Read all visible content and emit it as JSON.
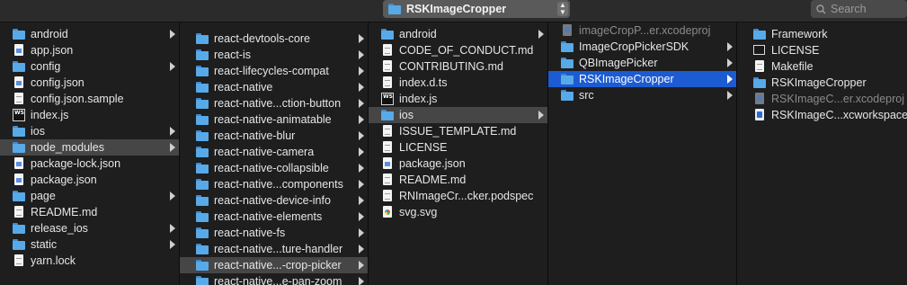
{
  "toolbar": {
    "path_title": "RSKImageCropper",
    "search_placeholder": "Search"
  },
  "columns": [
    {
      "name": "column-1",
      "items": [
        {
          "label": "android",
          "icon": "folder",
          "has_children": true
        },
        {
          "label": "app.json",
          "icon": "doc-blue"
        },
        {
          "label": "config",
          "icon": "folder",
          "has_children": true
        },
        {
          "label": "config.json",
          "icon": "doc-blue"
        },
        {
          "label": "config.json.sample",
          "icon": "doc"
        },
        {
          "label": "index.js",
          "icon": "webstorm"
        },
        {
          "label": "ios",
          "icon": "folder",
          "has_children": true
        },
        {
          "label": "node_modules",
          "icon": "folder",
          "has_children": true,
          "selected": "gray"
        },
        {
          "label": "package-lock.json",
          "icon": "doc-blue"
        },
        {
          "label": "package.json",
          "icon": "doc-blue"
        },
        {
          "label": "page",
          "icon": "folder",
          "has_children": true
        },
        {
          "label": "README.md",
          "icon": "doc"
        },
        {
          "label": "release_ios",
          "icon": "folder",
          "has_children": true
        },
        {
          "label": "static",
          "icon": "folder",
          "has_children": true
        },
        {
          "label": "yarn.lock",
          "icon": "doc"
        }
      ]
    },
    {
      "name": "column-2",
      "items": [
        {
          "label": "react-devtools-core",
          "icon": "folder",
          "has_children": true
        },
        {
          "label": "react-is",
          "icon": "folder",
          "has_children": true
        },
        {
          "label": "react-lifecycles-compat",
          "icon": "folder",
          "has_children": true
        },
        {
          "label": "react-native",
          "icon": "folder",
          "has_children": true
        },
        {
          "label": "react-native...ction-button",
          "icon": "folder",
          "has_children": true
        },
        {
          "label": "react-native-animatable",
          "icon": "folder",
          "has_children": true
        },
        {
          "label": "react-native-blur",
          "icon": "folder",
          "has_children": true
        },
        {
          "label": "react-native-camera",
          "icon": "folder",
          "has_children": true
        },
        {
          "label": "react-native-collapsible",
          "icon": "folder",
          "has_children": true
        },
        {
          "label": "react-native...components",
          "icon": "folder",
          "has_children": true
        },
        {
          "label": "react-native-device-info",
          "icon": "folder",
          "has_children": true
        },
        {
          "label": "react-native-elements",
          "icon": "folder",
          "has_children": true
        },
        {
          "label": "react-native-fs",
          "icon": "folder",
          "has_children": true
        },
        {
          "label": "react-native...ture-handler",
          "icon": "folder",
          "has_children": true
        },
        {
          "label": "react-native...-crop-picker",
          "icon": "folder",
          "has_children": true,
          "selected": "gray"
        },
        {
          "label": "react-native...e-pan-zoom",
          "icon": "folder",
          "has_children": true
        }
      ]
    },
    {
      "name": "column-3",
      "items": [
        {
          "label": "android",
          "icon": "folder",
          "has_children": true
        },
        {
          "label": "CODE_OF_CONDUCT.md",
          "icon": "doc"
        },
        {
          "label": "CONTRIBUTING.md",
          "icon": "doc"
        },
        {
          "label": "index.d.ts",
          "icon": "doc"
        },
        {
          "label": "index.js",
          "icon": "webstorm"
        },
        {
          "label": "ios",
          "icon": "folder",
          "has_children": true,
          "selected": "gray"
        },
        {
          "label": "ISSUE_TEMPLATE.md",
          "icon": "doc"
        },
        {
          "label": "LICENSE",
          "icon": "doc"
        },
        {
          "label": "package.json",
          "icon": "doc-blue"
        },
        {
          "label": "README.md",
          "icon": "doc"
        },
        {
          "label": "RNImageCr...cker.podspec",
          "icon": "doc"
        },
        {
          "label": "svg.svg",
          "icon": "svg"
        }
      ]
    },
    {
      "name": "column-4",
      "items": [
        {
          "label": "imageCropP...er.xcodeproj",
          "icon": "xcodeproj",
          "dim": true
        },
        {
          "label": "ImageCropPickerSDK",
          "icon": "folder",
          "has_children": true
        },
        {
          "label": "QBImagePicker",
          "icon": "folder",
          "has_children": true
        },
        {
          "label": "RSKImageCropper",
          "icon": "folder",
          "has_children": true,
          "selected": "blue"
        },
        {
          "label": "src",
          "icon": "folder",
          "has_children": true
        }
      ]
    },
    {
      "name": "column-5",
      "items": [
        {
          "label": "Framework",
          "icon": "folder"
        },
        {
          "label": "LICENSE",
          "icon": "terminal"
        },
        {
          "label": "Makefile",
          "icon": "doc"
        },
        {
          "label": "RSKImageCropper",
          "icon": "folder"
        },
        {
          "label": "RSKImageC...er.xcodeproj",
          "icon": "xcodeproj",
          "dim": true
        },
        {
          "label": "RSKImageC...xcworkspace",
          "icon": "xcworkspace"
        }
      ]
    }
  ]
}
